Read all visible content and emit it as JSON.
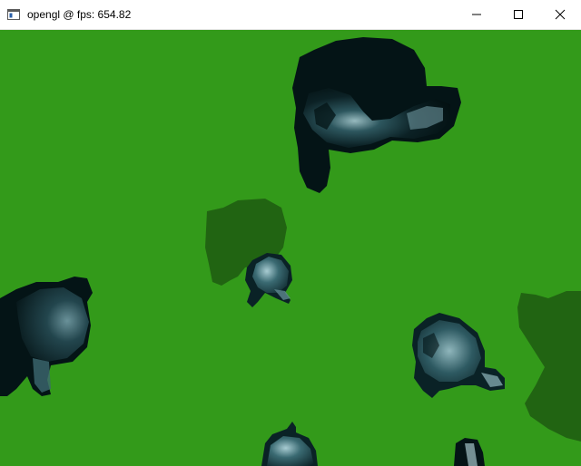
{
  "window": {
    "title": "opengl @ fps: 654.82",
    "app_icon": "console-window-icon",
    "buttons": {
      "minimize_icon": "minimize-icon",
      "maximize_icon": "maximize-icon",
      "close_icon": "close-icon"
    }
  },
  "scene": {
    "background_color": "#339a1a",
    "shadow_color": "#1f5a12",
    "model_colors": {
      "dark": "#041416",
      "mid": "#1a3c44",
      "light": "#7fa8b0"
    }
  }
}
